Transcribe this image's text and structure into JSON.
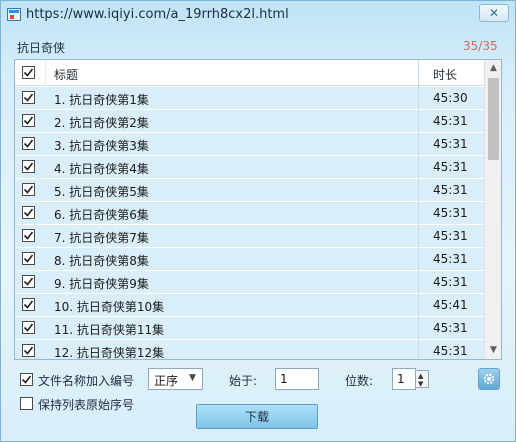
{
  "window": {
    "title": "https://www.iqiyi.com/a_19rrh8cx2l.html",
    "close_label": "✕"
  },
  "list": {
    "name": "抗日奇侠",
    "count": "35/35",
    "columns": {
      "title": "标题",
      "duration": "时长"
    },
    "rows": [
      {
        "title": "1. 抗日奇侠第1集",
        "duration": "45:30",
        "checked": true
      },
      {
        "title": "2. 抗日奇侠第2集",
        "duration": "45:31",
        "checked": true
      },
      {
        "title": "3. 抗日奇侠第3集",
        "duration": "45:31",
        "checked": true
      },
      {
        "title": "4. 抗日奇侠第4集",
        "duration": "45:31",
        "checked": true
      },
      {
        "title": "5. 抗日奇侠第5集",
        "duration": "45:31",
        "checked": true
      },
      {
        "title": "6. 抗日奇侠第6集",
        "duration": "45:31",
        "checked": true
      },
      {
        "title": "7. 抗日奇侠第7集",
        "duration": "45:31",
        "checked": true
      },
      {
        "title": "8. 抗日奇侠第8集",
        "duration": "45:31",
        "checked": true
      },
      {
        "title": "9. 抗日奇侠第9集",
        "duration": "45:31",
        "checked": true
      },
      {
        "title": "10. 抗日奇侠第10集",
        "duration": "45:41",
        "checked": true
      },
      {
        "title": "11. 抗日奇侠第11集",
        "duration": "45:31",
        "checked": true
      },
      {
        "title": "12. 抗日奇侠第12集",
        "duration": "45:31",
        "checked": true
      }
    ]
  },
  "options": {
    "add_number_label": "文件名称加入编号",
    "add_number_checked": true,
    "keep_order_label": "保持列表原始序号",
    "keep_order_checked": false,
    "order_value": "正序",
    "start_label": "始于:",
    "start_value": "1",
    "digits_label": "位数:",
    "digits_value": "1"
  },
  "download_label": "下载",
  "icons": {
    "settings": "gear-icon",
    "scroll_up": "chevron-up-icon",
    "scroll_down": "chevron-down-icon"
  },
  "colors": {
    "accent": "#7ec4ea",
    "row_bg": "#d9eef8",
    "count": "#d26a5b"
  }
}
